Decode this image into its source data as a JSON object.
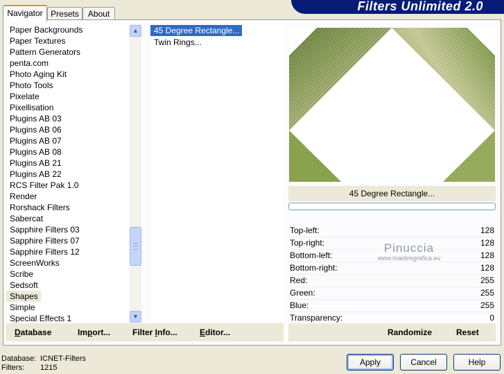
{
  "tabs": [
    {
      "label": "Navigator",
      "active": true
    },
    {
      "label": "Presets",
      "active": false
    },
    {
      "label": "About",
      "active": false
    }
  ],
  "banner": {
    "title": "Filters Unlimited 2.0"
  },
  "categories": {
    "items": [
      "Paper Backgrounds",
      "Paper Textures",
      "Pattern Generators",
      "penta.com",
      "Photo Aging Kit",
      "Photo Tools",
      "Pixelate",
      "Pixellisation",
      "Plugins AB 03",
      "Plugins AB 06",
      "Plugins AB 07",
      "Plugins AB 08",
      "Plugins AB 21",
      "Plugins AB 22",
      "RCS Filter Pak 1.0",
      "Render",
      "Rorshack Filters",
      "Sabercat",
      "Sapphire Filters 03",
      "Sapphire Filters 07",
      "Sapphire Filters 12",
      "ScreenWorks",
      "Scribe",
      "Sedsoft",
      "Shapes",
      "Simple",
      "Special Effects 1"
    ],
    "selected": "Shapes"
  },
  "filters": {
    "items": [
      "45 Degree Rectangle...",
      "Twin Rings..."
    ],
    "selected": "45 Degree Rectangle..."
  },
  "left_buttons": {
    "database": {
      "pre": "",
      "u": "D",
      "post": "atabase"
    },
    "import": {
      "pre": "Im",
      "u": "p",
      "post": "ort..."
    },
    "filter_info": {
      "pre": "Filter ",
      "u": "I",
      "post": "nfo..."
    },
    "editor": {
      "pre": "",
      "u": "E",
      "post": "ditor..."
    }
  },
  "preview": {
    "filter_name": "45 Degree Rectangle...",
    "progress": 0
  },
  "params": [
    {
      "label": "Top-left:",
      "value": "128"
    },
    {
      "label": "Top-right:",
      "value": "128"
    },
    {
      "label": "Bottom-left:",
      "value": "128"
    },
    {
      "label": "Bottom-right:",
      "value": "128"
    },
    {
      "label": "Red:",
      "value": "255"
    },
    {
      "label": "Green:",
      "value": "255"
    },
    {
      "label": "Blue:",
      "value": "255"
    },
    {
      "label": "Transparency:",
      "value": "0"
    }
  ],
  "watermark": {
    "name": "Pinuccia",
    "site": "www.maidiregrafica.eu"
  },
  "right_buttons": {
    "randomize": "Randomize",
    "reset": "Reset"
  },
  "info": {
    "database_label": "Database:",
    "database_value": "ICNET-Filters",
    "filters_label": "Filters:",
    "filters_value": "1215"
  },
  "dialog_buttons": {
    "apply": "Apply",
    "cancel": "Cancel",
    "help": "Help"
  },
  "colors": {
    "accent": "#316ac5",
    "banner": "#061c77",
    "tab_highlight": "#e68b2c"
  }
}
